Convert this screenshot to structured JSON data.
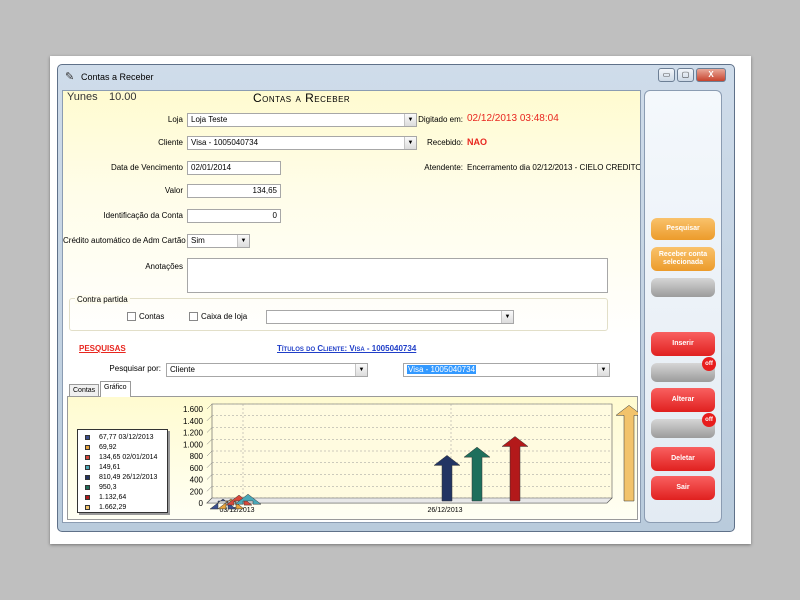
{
  "window": {
    "title": "Contas a Receber",
    "min": "▭",
    "max": "▢",
    "close": "X"
  },
  "header": {
    "user": "Yunes",
    "version": "10.00",
    "title": "Contas a Receber"
  },
  "form": {
    "loja_label": "Loja",
    "loja_value": "Loja Teste",
    "cliente_label": "Cliente",
    "cliente_value": "Visa - 1005040734",
    "vencimento_label": "Data de Vencimento",
    "vencimento_value": "02/01/2014",
    "valor_label": "Valor",
    "valor_value": "134,65",
    "identificacao_label": "Identificação da Conta",
    "identificacao_value": "0",
    "credito_label": "Crédito automático de Adm Cartão",
    "credito_value": "Sim",
    "anotacoes_label": "Anotações",
    "digitado_label": "Digitado em:",
    "digitado_value": "02/12/2013 03:48:04",
    "recebido_label": "Recebido:",
    "recebido_value": "NAO",
    "atendente_label": "Atendente:",
    "atendente_value": "Encerramento dia 02/12/2013 - CIELO CREDITO"
  },
  "contra": {
    "title": "Contra partida",
    "contas": "Contas",
    "caixa": "Caixa de loja"
  },
  "search": {
    "pesquisas": "PESQUISAS",
    "titulos": "Títulos do Cliente: Visa - 1005040734",
    "pesquisar_por_label": "Pesquisar por:",
    "pesquisar_por_value": "Cliente",
    "cliente_value": "Visa - 1005040734"
  },
  "tabs": [
    "Contas",
    "Gráfico"
  ],
  "sidebar": {
    "pesquisar": "Pesquisar",
    "receber": "Receber conta selecionada",
    "inserir": "Inserir",
    "alterar": "Alterar",
    "deletar": "Deletar",
    "sair": "Sair",
    "off1": "off",
    "off2": "off"
  },
  "colors": {
    "accent_red": "#e8261f",
    "orange": "#ec9b2b",
    "title_blue": "#1f3ec8"
  },
  "chart_data": {
    "type": "bar",
    "yticks": [
      "0",
      "200",
      "400",
      "600",
      "800",
      "1.000",
      "1.200",
      "1.400",
      "1.600"
    ],
    "ylim": [
      0,
      1600
    ],
    "xticks": [
      "03/12/2013",
      "26/12/2013"
    ],
    "legend": [
      {
        "label": "67,77 03/12/2013",
        "color": "#3a4f8f"
      },
      {
        "label": "69,92",
        "color": "#e8a43c"
      },
      {
        "label": "134,65 02/01/2014",
        "color": "#d8483a"
      },
      {
        "label": "149,61",
        "color": "#4aa8b8"
      },
      {
        "label": "810,49 26/12/2013",
        "color": "#223463"
      },
      {
        "label": "950,3",
        "color": "#1e6f5c"
      },
      {
        "label": "1.132,64",
        "color": "#b3191a"
      },
      {
        "label": "1.662,29",
        "color": "#f2c36b"
      }
    ],
    "values": [
      67.77,
      69.92,
      134.65,
      149.61,
      810.49,
      950.3,
      1132.64,
      1662.29
    ]
  }
}
